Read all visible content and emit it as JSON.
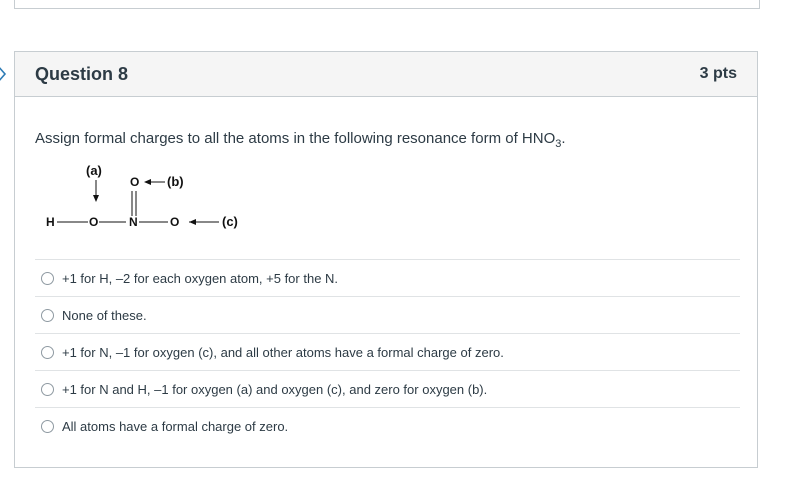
{
  "question": {
    "title": "Question 8",
    "points": "3 pts",
    "prompt_main": "Assign formal charges to all the atoms in the following resonance form of HNO",
    "prompt_sub": "3",
    "prompt_end": "."
  },
  "diagram": {
    "labels": {
      "a": "(a)",
      "b": "(b)",
      "c": "(c)"
    },
    "atoms": {
      "h": "H",
      "o1": "O",
      "n": "N",
      "o2": "O",
      "o3": "O"
    }
  },
  "answers": [
    "+1 for H, –2 for each oxygen atom, +5 for the N.",
    "None of these.",
    "+1 for N, –1 for oxygen (c), and all other atoms have a formal charge of zero.",
    "+1 for N and H, –1 for oxygen (a) and oxygen (c), and zero for oxygen (b).",
    "All atoms have a formal charge of zero."
  ],
  "icons": {
    "nav": "chevron-right-icon"
  },
  "colors": {
    "accent": "#2d7bb5",
    "border": "#c7cdd1",
    "header_bg": "#f5f5f5",
    "text": "#2d3b45"
  }
}
